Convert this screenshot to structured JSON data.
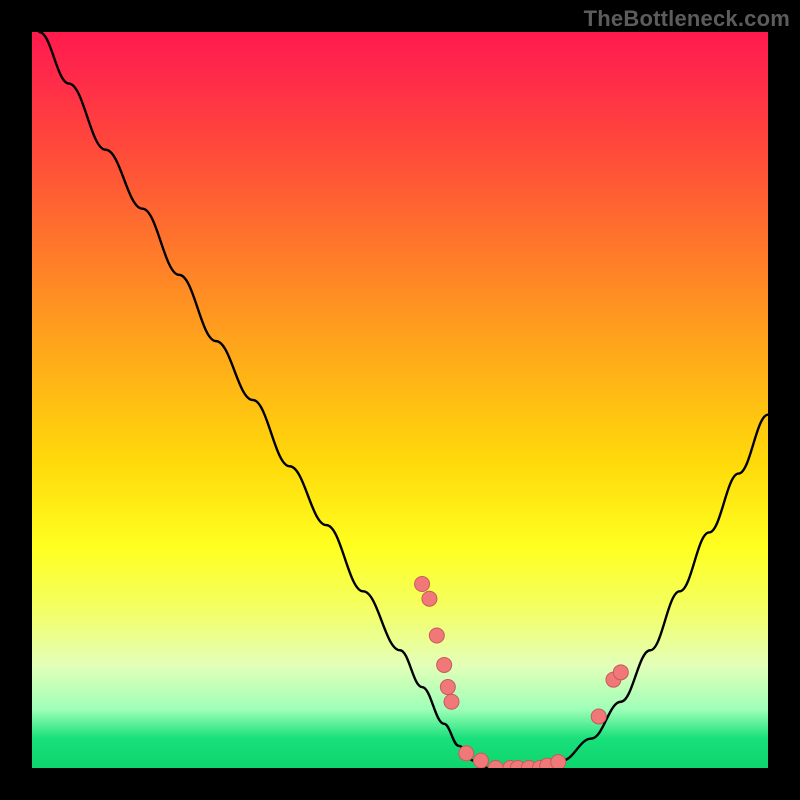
{
  "watermark": "TheBottleneck.com",
  "colors": {
    "background": "#000000",
    "curve": "#000000",
    "marker_fill": "#f07878",
    "marker_stroke": "#c95a5a"
  },
  "chart_data": {
    "type": "line",
    "title": "",
    "xlabel": "",
    "ylabel": "",
    "xlim": [
      0,
      100
    ],
    "ylim": [
      0,
      100
    ],
    "note": "V-shaped bottleneck curve. x is relative horizontal position (0-100), y is bottleneck percentage (0 optimal, 100 worst). Values estimated from pixel positions; no axis ticks present.",
    "series": [
      {
        "name": "bottleneck-curve",
        "x": [
          1,
          5,
          10,
          15,
          20,
          25,
          30,
          35,
          40,
          45,
          50,
          53,
          56,
          58,
          60,
          62,
          65,
          68,
          72,
          76,
          80,
          84,
          88,
          92,
          96,
          100
        ],
        "y": [
          100,
          93,
          84,
          76,
          67,
          58,
          50,
          41,
          33,
          24,
          16,
          11,
          6,
          3,
          1,
          0,
          0,
          0,
          1,
          4,
          9,
          16,
          24,
          32,
          40,
          48
        ]
      }
    ],
    "markers": [
      {
        "x": 53,
        "y": 25
      },
      {
        "x": 54,
        "y": 23
      },
      {
        "x": 55,
        "y": 18
      },
      {
        "x": 56,
        "y": 14
      },
      {
        "x": 56.5,
        "y": 11
      },
      {
        "x": 57,
        "y": 9
      },
      {
        "x": 59,
        "y": 2
      },
      {
        "x": 61,
        "y": 1
      },
      {
        "x": 63,
        "y": 0
      },
      {
        "x": 65,
        "y": 0
      },
      {
        "x": 66,
        "y": 0
      },
      {
        "x": 67.5,
        "y": 0
      },
      {
        "x": 69,
        "y": 0
      },
      {
        "x": 70,
        "y": 0.3
      },
      {
        "x": 71.5,
        "y": 0.8
      },
      {
        "x": 77,
        "y": 7
      },
      {
        "x": 79,
        "y": 12
      },
      {
        "x": 80,
        "y": 13
      }
    ]
  }
}
